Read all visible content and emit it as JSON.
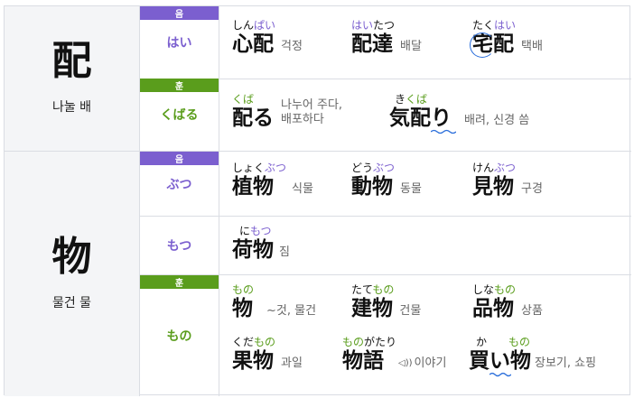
{
  "rows": [
    {
      "kanji": "配",
      "meaning": "나눌 배",
      "on": {
        "tag": "음",
        "reading": "はい",
        "words": [
          {
            "furi_pre": "しん",
            "furi_hl": "ぱい",
            "furi_post": "",
            "kanji": "心配",
            "trans": "걱정"
          },
          {
            "furi_pre": "",
            "furi_hl": "はい",
            "furi_post": "たつ",
            "kanji": "配達",
            "trans": "배달"
          },
          {
            "furi_pre": "たく",
            "furi_hl": "はい",
            "furi_post": "",
            "kanji_a": "宅",
            "kanji_b": "配",
            "trans": "택배"
          }
        ]
      },
      "kun": {
        "tag": "훈",
        "reading": "くばる",
        "words": [
          {
            "furi_pre": "",
            "furi_hl": "くば",
            "furi_post": "",
            "kanji": "配る",
            "trans_line1": "나누어 주다,",
            "trans_line2": "배포하다"
          },
          {
            "furi_pre": "き",
            "furi_hl": "くば",
            "furi_post": "",
            "kanji_a": "気配",
            "kanji_b": "り",
            "trans": "배려, 신경 씀"
          }
        ]
      }
    },
    {
      "kanji": "物",
      "meaning": "물건 물",
      "on": {
        "tag": "음",
        "reading": "ぶつ",
        "words": [
          {
            "furi_pre": "しょく",
            "furi_hl": "ぶつ",
            "furi_post": "",
            "kanji": "植物",
            "trans": "식물"
          },
          {
            "furi_pre": "どう",
            "furi_hl": "ぶつ",
            "furi_post": "",
            "kanji": "動物",
            "trans": "동물"
          },
          {
            "furi_pre": "けん",
            "furi_hl": "ぶつ",
            "furi_post": "",
            "kanji": "見物",
            "trans": "구경"
          }
        ]
      },
      "on2": {
        "reading": "もつ",
        "words": [
          {
            "furi_pre": "に",
            "furi_hl": "もつ",
            "furi_post": "",
            "kanji": "荷物",
            "trans": "짐"
          }
        ]
      },
      "kun": {
        "tag": "훈",
        "reading": "もの",
        "words": [
          {
            "furi_pre": "",
            "furi_hl": "もの",
            "furi_post": "",
            "kanji": "物",
            "trans": "~것, 물건"
          },
          {
            "furi_pre": "たて",
            "furi_hl": "もの",
            "furi_post": "",
            "kanji": "建物",
            "trans": "건물"
          },
          {
            "furi_pre": "しな",
            "furi_hl": "もの",
            "furi_post": "",
            "kanji": "品物",
            "trans": "상품"
          },
          {
            "furi_pre": "くだ",
            "furi_hl": "もの",
            "furi_post": "",
            "kanji": "果物",
            "trans": "과일"
          },
          {
            "furi_pre": "",
            "furi_hl": "もの",
            "furi_post": "がたり",
            "kanji": "物語",
            "sound": "◁))",
            "trans": "이야기"
          },
          {
            "furi_pre": "か",
            "furi_mid": "　　",
            "furi_hl": "もの",
            "furi_post": "",
            "kanji_a": "買",
            "kanji_wave": "い",
            "kanji_b": "物",
            "trans": "장보기, 쇼핑"
          }
        ]
      }
    }
  ]
}
